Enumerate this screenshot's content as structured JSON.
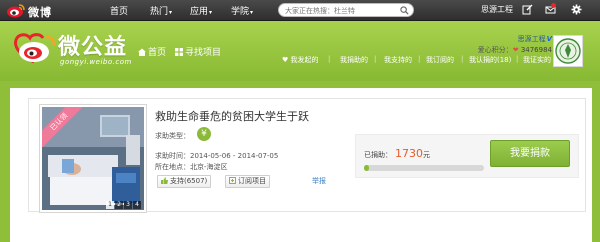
{
  "topbar": {
    "logo_text": "微博",
    "nav": [
      {
        "label": "首页",
        "has_caret": false
      },
      {
        "label": "热门",
        "has_caret": true
      },
      {
        "label": "应用",
        "has_caret": true
      },
      {
        "label": "学院",
        "has_caret": true
      }
    ],
    "search": {
      "placeholder": "大家正在热搜：杜兰特",
      "icon": "search-icon"
    },
    "user_name": "思源工程",
    "icons": [
      "edit-icon",
      "mail-icon",
      "gear-icon"
    ]
  },
  "header": {
    "brand_title": "微公益",
    "brand_sub": "gongyi.weibo.com",
    "nav": [
      {
        "label": "首页",
        "icon": "home-icon"
      },
      {
        "label": "寻找项目",
        "icon": "grid-icon"
      }
    ],
    "user": {
      "name": "思源工程",
      "verified": "V",
      "love_label": "爱心积分：",
      "love_value": "3476984"
    },
    "subnav": [
      "我发起的",
      "我捐助的",
      "我支持的",
      "我订阅的",
      "我认捐的(18)",
      "我证实的"
    ]
  },
  "project": {
    "ribbon": "已认领",
    "title": "救助生命垂危的贫困大学生于跃",
    "type_label": "求助类型：",
    "type_icon": "¥",
    "time_label": "求助时间：",
    "time_value": "2014-05-06 - 2014-07-05",
    "place_label": "所在地点：",
    "place_value": "北京-海淀区",
    "pager": [
      "1",
      "2",
      "3",
      "4"
    ],
    "support_label": "支持(6507)",
    "subscribe_label": "订阅项目",
    "report_label": "举报",
    "raised_label": "已捐助：",
    "raised_amount": "1730",
    "raised_unit": "元",
    "progress_percent": 4,
    "donate_label": "我要捐款"
  },
  "colors": {
    "brand_green": "#8bba3a",
    "amount_orange": "#e85a2a",
    "ribbon_pink": "#f07a9a"
  }
}
